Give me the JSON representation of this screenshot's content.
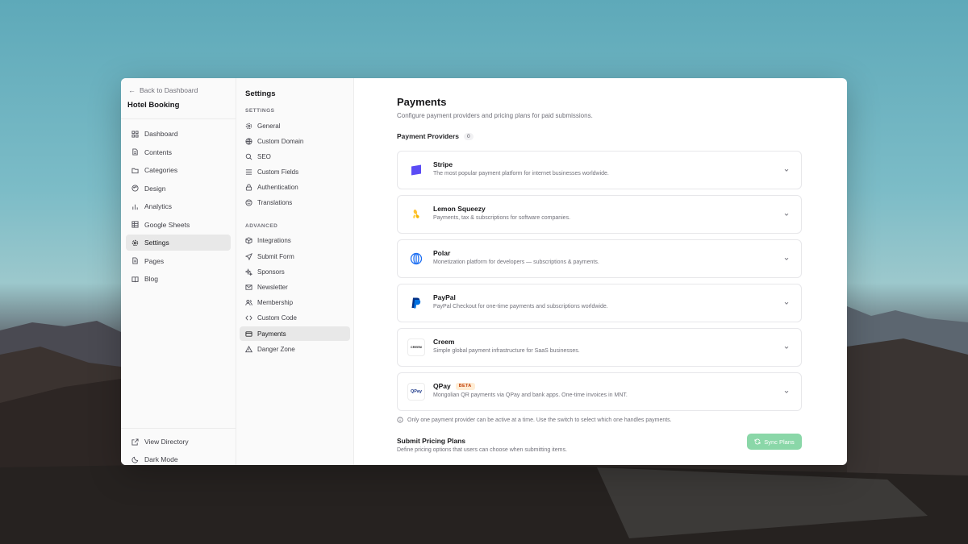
{
  "sidebar": {
    "back_label": "Back to Dashboard",
    "project_name": "Hotel Booking",
    "items": [
      {
        "label": "Dashboard",
        "icon": "grid-icon"
      },
      {
        "label": "Contents",
        "icon": "file-icon"
      },
      {
        "label": "Categories",
        "icon": "folder-icon"
      },
      {
        "label": "Design",
        "icon": "palette-icon"
      },
      {
        "label": "Analytics",
        "icon": "bar-chart-icon"
      },
      {
        "label": "Google Sheets",
        "icon": "table-icon"
      },
      {
        "label": "Settings",
        "icon": "gear-icon",
        "active": true
      },
      {
        "label": "Pages",
        "icon": "page-icon"
      },
      {
        "label": "Blog",
        "icon": "book-icon"
      }
    ],
    "footer": [
      {
        "label": "View Directory",
        "icon": "external-link-icon"
      },
      {
        "label": "Dark Mode",
        "icon": "moon-icon"
      }
    ]
  },
  "settings_nav": {
    "title": "Settings",
    "settings_label": "SETTINGS",
    "settings_items": [
      {
        "label": "General",
        "icon": "gear-icon"
      },
      {
        "label": "Custom Domain",
        "icon": "globe-icon"
      },
      {
        "label": "SEO",
        "icon": "search-icon"
      },
      {
        "label": "Custom Fields",
        "icon": "list-icon"
      },
      {
        "label": "Authentication",
        "icon": "lock-icon"
      },
      {
        "label": "Translations",
        "icon": "languages-icon"
      }
    ],
    "advanced_label": "ADVANCED",
    "advanced_items": [
      {
        "label": "Integrations",
        "icon": "box-icon"
      },
      {
        "label": "Submit Form",
        "icon": "send-icon"
      },
      {
        "label": "Sponsors",
        "icon": "sparkles-icon"
      },
      {
        "label": "Newsletter",
        "icon": "mail-icon"
      },
      {
        "label": "Membership",
        "icon": "users-icon"
      },
      {
        "label": "Custom Code",
        "icon": "code-icon"
      },
      {
        "label": "Payments",
        "icon": "credit-card-icon",
        "active": true
      },
      {
        "label": "Danger Zone",
        "icon": "warning-icon"
      }
    ]
  },
  "main": {
    "title": "Payments",
    "description": "Configure payment providers and pricing plans for paid submissions.",
    "providers_label": "Payment Providers",
    "providers_count": "0",
    "providers": [
      {
        "name": "Stripe",
        "desc": "The most popular payment platform for internet businesses worldwide.",
        "icon": "stripe-logo-icon",
        "color": "#635bff"
      },
      {
        "name": "Lemon Squeezy",
        "desc": "Payments, tax & subscriptions for software companies.",
        "icon": "lemon-squeezy-logo-icon",
        "color": "#ffc233"
      },
      {
        "name": "Polar",
        "desc": "Monetization platform for developers — subscriptions & payments.",
        "icon": "polar-logo-icon",
        "color": "#1c6ef2"
      },
      {
        "name": "PayPal",
        "desc": "PayPal Checkout for one-time payments and subscriptions worldwide.",
        "icon": "paypal-logo-icon",
        "color": "#003087"
      },
      {
        "name": "Creem",
        "desc": "Simple global payment infrastructure for SaaS businesses.",
        "icon": "creem-logo-icon",
        "logo_text": "CREEM"
      },
      {
        "name": "QPay",
        "badge": "BETA",
        "desc": "Mongolian QR payments via QPay and bank apps. One-time invoices in MNT.",
        "icon": "qpay-logo-icon",
        "logo_text": "QPay"
      }
    ],
    "note": "Only one payment provider can be active at a time. Use the switch to select which one handles payments.",
    "pricing_title": "Submit Pricing Plans",
    "pricing_desc": "Define pricing options that users can choose when submitting items.",
    "sync_label": "Sync Plans",
    "accent_color": "#8ad7a8"
  }
}
